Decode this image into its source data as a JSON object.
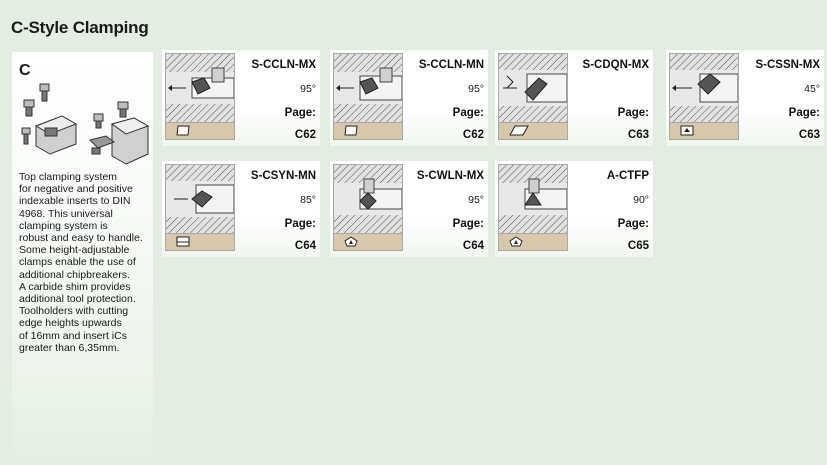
{
  "header": {
    "title": "C-Style Clamping"
  },
  "intro": {
    "letter": "C",
    "lines": [
      "Top clamping system",
      "for negative and positive",
      "indexable inserts to DIN",
      "4968. This universal",
      "clamping system is",
      "robust and easy to handle.",
      "Some height-adjustable",
      "clamps enable the use of",
      "additional chipbreakers.",
      "A carbide shim provides",
      "additional tool protection.",
      "Toolholders with cutting",
      "edge heights upwards",
      "of 16mm and insert iCs",
      "greater than 6,35mm."
    ]
  },
  "page_label": "Page:",
  "cards": [
    {
      "code": "S-CCLN-MX",
      "angle": "95°",
      "page": "C62",
      "insert_icon": "rhombus-80-insert-icon"
    },
    {
      "code": "S-CCLN-MN",
      "angle": "95°",
      "page": "C62",
      "insert_icon": "rhombus-80-insert-icon"
    },
    {
      "code": "S-CDQN-MX",
      "angle": "",
      "page": "C63",
      "insert_icon": "rhombus-55-insert-icon"
    },
    {
      "code": "S-CSSN-MX",
      "angle": "45°",
      "page": "C63",
      "insert_icon": "square-insert-icon"
    },
    {
      "code": "S-CSYN-MN",
      "angle": "85°",
      "page": "C64",
      "insert_icon": "square-insert-icon"
    },
    {
      "code": "S-CWLN-MX",
      "angle": "95°",
      "page": "C64",
      "insert_icon": "trigon-insert-icon"
    },
    {
      "code": "A-CTFP",
      "angle": "90°",
      "page": "C65",
      "insert_icon": "triangle-insert-icon"
    }
  ],
  "colors": {
    "background": "#e3ede1",
    "card": "#ffffff",
    "insert_strip": "#d8c8ab",
    "text": "#111111"
  }
}
